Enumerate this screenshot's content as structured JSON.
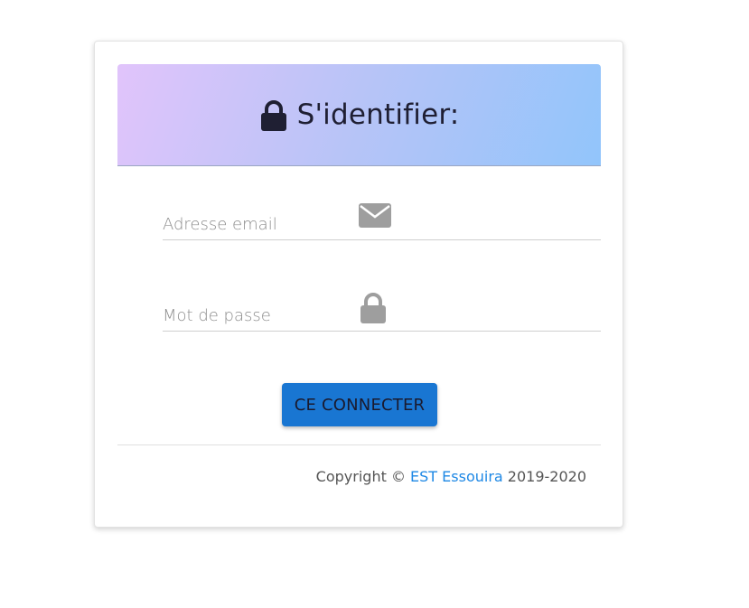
{
  "header": {
    "icon": "lock-icon",
    "title": "S'identifier:",
    "gradient": [
      "#e1c4fb",
      "#92c5fb"
    ]
  },
  "form": {
    "email": {
      "placeholder": "Adresse email",
      "value": "",
      "icon": "envelope-icon"
    },
    "password": {
      "placeholder": "Mot de passe",
      "value": "",
      "icon": "lock-icon"
    },
    "submit_label": "CE CONNECTER",
    "submit_color": "#1976d2"
  },
  "footer": {
    "prefix": "Copyright © ",
    "link_text": "EST Essouira",
    "suffix": " 2019-2020",
    "link_color": "#1e88e5"
  }
}
